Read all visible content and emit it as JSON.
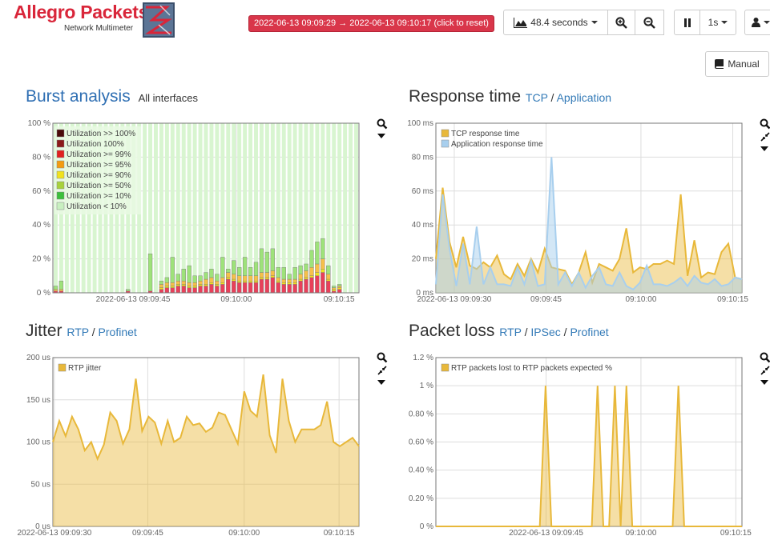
{
  "header": {
    "logo_title": "Allegro Packets",
    "logo_subtitle": "Network Multimeter",
    "time_range": "2022-06-13 09:09:29 → 2022-06-13 09:10:17 (click to reset)",
    "window_label": "48.4 seconds",
    "interval_label": "1s",
    "manual_label": "Manual"
  },
  "icons": {
    "chart": "area-chart-icon",
    "zoom_in": "zoom-in-icon",
    "zoom_out": "zoom-out-icon",
    "pause": "pause-icon",
    "user": "user-icon",
    "book": "book-icon",
    "search": "search-icon",
    "compress": "compress-icon",
    "dropdown": "caret-down-icon"
  },
  "burst": {
    "title": "Burst analysis",
    "subtitle": "All interfaces",
    "legend": [
      "Utilization >> 100%",
      "Utilization 100%",
      "Utilization >= 99%",
      "Utilization >= 95%",
      "Utilization >= 90%",
      "Utilization >= 50%",
      "Utilization >= 10%",
      "Utilization < 10%"
    ],
    "legend_colors": [
      "#4a0a0a",
      "#8b1a1a",
      "#e02020",
      "#f39c12",
      "#f1e21e",
      "#a8d23c",
      "#3cbf3c",
      "#c8f0c0"
    ]
  },
  "response": {
    "title": "Response time",
    "links": [
      "TCP",
      "Application"
    ],
    "legend": [
      "TCP response time",
      "Application response time"
    ]
  },
  "jitter": {
    "title": "Jitter",
    "links": [
      "RTP",
      "Profinet"
    ],
    "legend": [
      "RTP jitter"
    ]
  },
  "loss": {
    "title": "Packet loss",
    "links": [
      "RTP",
      "IPSec",
      "Profinet"
    ],
    "legend": [
      "RTP packets lost to RTP packets expected %"
    ]
  },
  "chart_data": [
    {
      "type": "bar",
      "name": "burst",
      "x_ticks": [
        "2022-06-13 09:09:45",
        "09:10:00",
        "09:10:15"
      ],
      "y_ticks": [
        "0 %",
        "20 %",
        "40 %",
        "60 %",
        "80 %",
        "100 %"
      ],
      "ylim": [
        0,
        100
      ],
      "grid": true,
      "legend_position": "top-left",
      "series": [
        {
          "name": "Utilization >= 99%",
          "values": [
            1,
            1,
            0,
            0,
            0,
            0,
            0,
            0,
            0,
            0,
            0,
            0,
            0,
            1,
            0,
            0,
            0,
            1,
            0,
            2,
            3,
            3,
            4,
            4,
            3,
            3,
            4,
            4,
            5,
            4,
            5,
            8,
            7,
            6,
            6,
            6,
            6,
            8,
            8,
            9,
            6,
            5,
            5,
            5,
            7,
            8,
            9,
            10,
            12,
            7,
            1,
            2,
            0,
            0,
            0
          ]
        },
        {
          "name": "Utilization >= 90%",
          "values": [
            0,
            0,
            0,
            0,
            0,
            0,
            0,
            0,
            0,
            0,
            0,
            0,
            0,
            0,
            0,
            0,
            0,
            0,
            0,
            1,
            1,
            1,
            1,
            1,
            1,
            1,
            1,
            1,
            1,
            1,
            1,
            1,
            1,
            1,
            1,
            1,
            1,
            1,
            1,
            1,
            1,
            1,
            1,
            1,
            1,
            1,
            1,
            2,
            2,
            1,
            1,
            1,
            0,
            0,
            0
          ]
        },
        {
          "name": "Utilization >= 50%",
          "values": [
            1,
            1,
            0,
            0,
            0,
            0,
            0,
            0,
            0,
            0,
            0,
            0,
            0,
            0,
            0,
            0,
            0,
            0,
            0,
            2,
            2,
            2,
            2,
            2,
            2,
            2,
            2,
            3,
            3,
            2,
            3,
            3,
            3,
            3,
            3,
            3,
            3,
            3,
            3,
            3,
            2,
            2,
            2,
            2,
            3,
            4,
            5,
            5,
            6,
            3,
            1,
            1,
            0,
            0,
            0
          ]
        },
        {
          "name": "Utilization >= 10%",
          "values": [
            2,
            5,
            0,
            0,
            0,
            0,
            0,
            0,
            0,
            0,
            0,
            0,
            0,
            1,
            0,
            0,
            0,
            22,
            0,
            2,
            3,
            15,
            4,
            7,
            10,
            4,
            3,
            4,
            5,
            4,
            12,
            2,
            8,
            5,
            11,
            5,
            8,
            14,
            12,
            13,
            6,
            7,
            3,
            7,
            5,
            4,
            10,
            13,
            12,
            5,
            1,
            1,
            0,
            0,
            0
          ]
        },
        {
          "name": "Utilization < 10%",
          "values": [
            0,
            0,
            0,
            0,
            0,
            0,
            0,
            0,
            0,
            0,
            0,
            0,
            0,
            0,
            0,
            0,
            0,
            0,
            0,
            0,
            0,
            0,
            0,
            0,
            0,
            0,
            0,
            0,
            0,
            0,
            0,
            0,
            0,
            0,
            0,
            0,
            0,
            0,
            0,
            0,
            0,
            0,
            0,
            0,
            0,
            0,
            0,
            0,
            0,
            0,
            0,
            0,
            0,
            0,
            0
          ]
        }
      ]
    },
    {
      "type": "area",
      "name": "response",
      "x_ticks": [
        "2022-06-13 09:09:30",
        "09:09:45",
        "09:10:00",
        "09:10:15"
      ],
      "y_ticks": [
        "0 ms",
        "20 ms",
        "40 ms",
        "60 ms",
        "80 ms",
        "100 ms"
      ],
      "ylim": [
        0,
        100
      ],
      "grid": true,
      "legend_position": "top-left",
      "series": [
        {
          "name": "TCP response time",
          "color": "#e8b83a",
          "values": [
            20,
            62,
            30,
            15,
            33,
            16,
            14,
            18,
            15,
            22,
            11,
            8,
            17,
            10,
            20,
            12,
            26,
            15,
            14,
            13,
            5,
            12,
            24,
            6,
            17,
            15,
            13,
            20,
            38,
            12,
            15,
            14,
            17,
            17,
            19,
            17,
            58,
            10,
            31,
            9,
            12,
            11,
            24,
            29,
            9,
            8
          ]
        },
        {
          "name": "Application response time",
          "color": "#a8cfee",
          "values": [
            5,
            58,
            26,
            4,
            29,
            5,
            39,
            5,
            15,
            5,
            5,
            4,
            15,
            5,
            19,
            4,
            5,
            80,
            5,
            12,
            4,
            12,
            3,
            10,
            15,
            5,
            4,
            12,
            4,
            2,
            6,
            16,
            5,
            5,
            4,
            6,
            9,
            4,
            10,
            6,
            5,
            8,
            4,
            5,
            9,
            8
          ]
        }
      ]
    },
    {
      "type": "area",
      "name": "jitter",
      "x_ticks": [
        "2022-06-13 09:09:30",
        "09:09:45",
        "09:10:00",
        "09:10:15"
      ],
      "y_ticks": [
        "0 us",
        "50 us",
        "100 us",
        "150 us",
        "200 us"
      ],
      "ylim": [
        0,
        200
      ],
      "grid": true,
      "legend_position": "top-left",
      "series": [
        {
          "name": "RTP jitter",
          "color": "#e8b83a",
          "values": [
            100,
            125,
            107,
            130,
            115,
            90,
            100,
            80,
            97,
            135,
            125,
            98,
            115,
            175,
            113,
            130,
            123,
            98,
            125,
            100,
            105,
            130,
            120,
            122,
            112,
            117,
            135,
            132,
            115,
            98,
            160,
            137,
            130,
            180,
            108,
            87,
            175,
            125,
            100,
            115,
            115,
            115,
            120,
            148,
            100,
            95,
            100,
            105,
            95
          ]
        }
      ]
    },
    {
      "type": "area",
      "name": "loss",
      "x_ticks": [
        "2022-06-13 09:09:45",
        "09:10:00",
        "09:10:15"
      ],
      "y_ticks": [
        "0 %",
        "0.20 %",
        "0.40 %",
        "0.60 %",
        "0.80 %",
        "1 %",
        "1.2 %"
      ],
      "ylim": [
        0,
        1.2
      ],
      "grid": true,
      "legend_position": "top-left",
      "series": [
        {
          "name": "RTP packets lost to RTP packets expected %",
          "color": "#e8b83a",
          "values": [
            0,
            0,
            0,
            0,
            0,
            0,
            0,
            0,
            0,
            0,
            0,
            0,
            0,
            0,
            0,
            0,
            0,
            0,
            0,
            1,
            0,
            0,
            0,
            0,
            0,
            0,
            0,
            0,
            1,
            0,
            0,
            1,
            0,
            1,
            0,
            0,
            0,
            0,
            0,
            0,
            0,
            0,
            1,
            0,
            0,
            0,
            0,
            0,
            0,
            0,
            0,
            0,
            0,
            0
          ]
        }
      ]
    }
  ]
}
